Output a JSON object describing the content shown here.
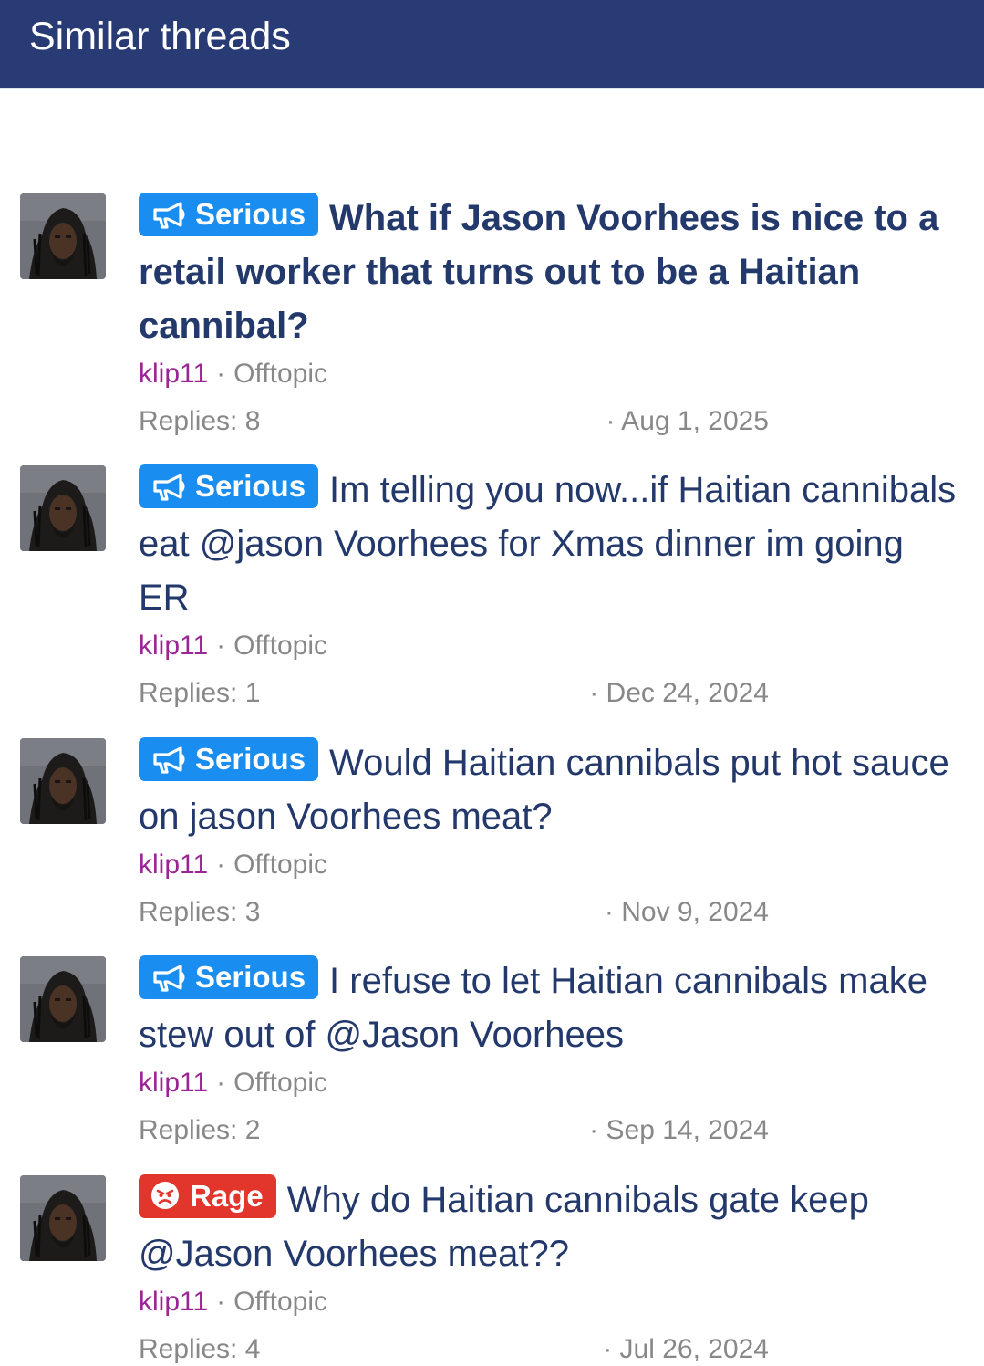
{
  "header": {
    "title": "Similar threads"
  },
  "threads": [
    {
      "prefix": "Serious",
      "prefix_type": "serious",
      "prefix_icon": "megaphone-icon",
      "title": "What if Jason Voorhees is nice to a retail worker that turns out to be a Haitian cannibal?",
      "bold": true,
      "author": "klip11",
      "separator": "·",
      "forum": "Offtopic",
      "replies": "Replies: 8",
      "date": "· Aug 1, 2025"
    },
    {
      "prefix": "Serious",
      "prefix_type": "serious",
      "prefix_icon": "megaphone-icon",
      "title": "Im telling you now...if Haitian cannibals eat @jason Voorhees for Xmas dinner im going ER",
      "bold": false,
      "author": "klip11",
      "separator": "·",
      "forum": "Offtopic",
      "replies": "Replies: 1",
      "date": "· Dec 24, 2024"
    },
    {
      "prefix": "Serious",
      "prefix_type": "serious",
      "prefix_icon": "megaphone-icon",
      "title": "Would Haitian cannibals put hot sauce on jason Voorhees meat?",
      "bold": false,
      "author": "klip11",
      "separator": "·",
      "forum": "Offtopic",
      "replies": "Replies: 3",
      "date": "· Nov 9, 2024"
    },
    {
      "prefix": "Serious",
      "prefix_type": "serious",
      "prefix_icon": "megaphone-icon",
      "title": "I refuse to let Haitian cannibals make stew out of @Jason Voorhees",
      "bold": false,
      "author": "klip11",
      "separator": "·",
      "forum": "Offtopic",
      "replies": "Replies: 2",
      "date": "· Sep 14, 2024"
    },
    {
      "prefix": "Rage",
      "prefix_type": "rage",
      "prefix_icon": "angry-face-icon",
      "title": "Why do Haitian cannibals gate keep @Jason Voorhees meat??",
      "bold": false,
      "author": "klip11",
      "separator": "·",
      "forum": "Offtopic",
      "replies": "Replies: 4",
      "date": "· Jul 26, 2024"
    }
  ]
}
